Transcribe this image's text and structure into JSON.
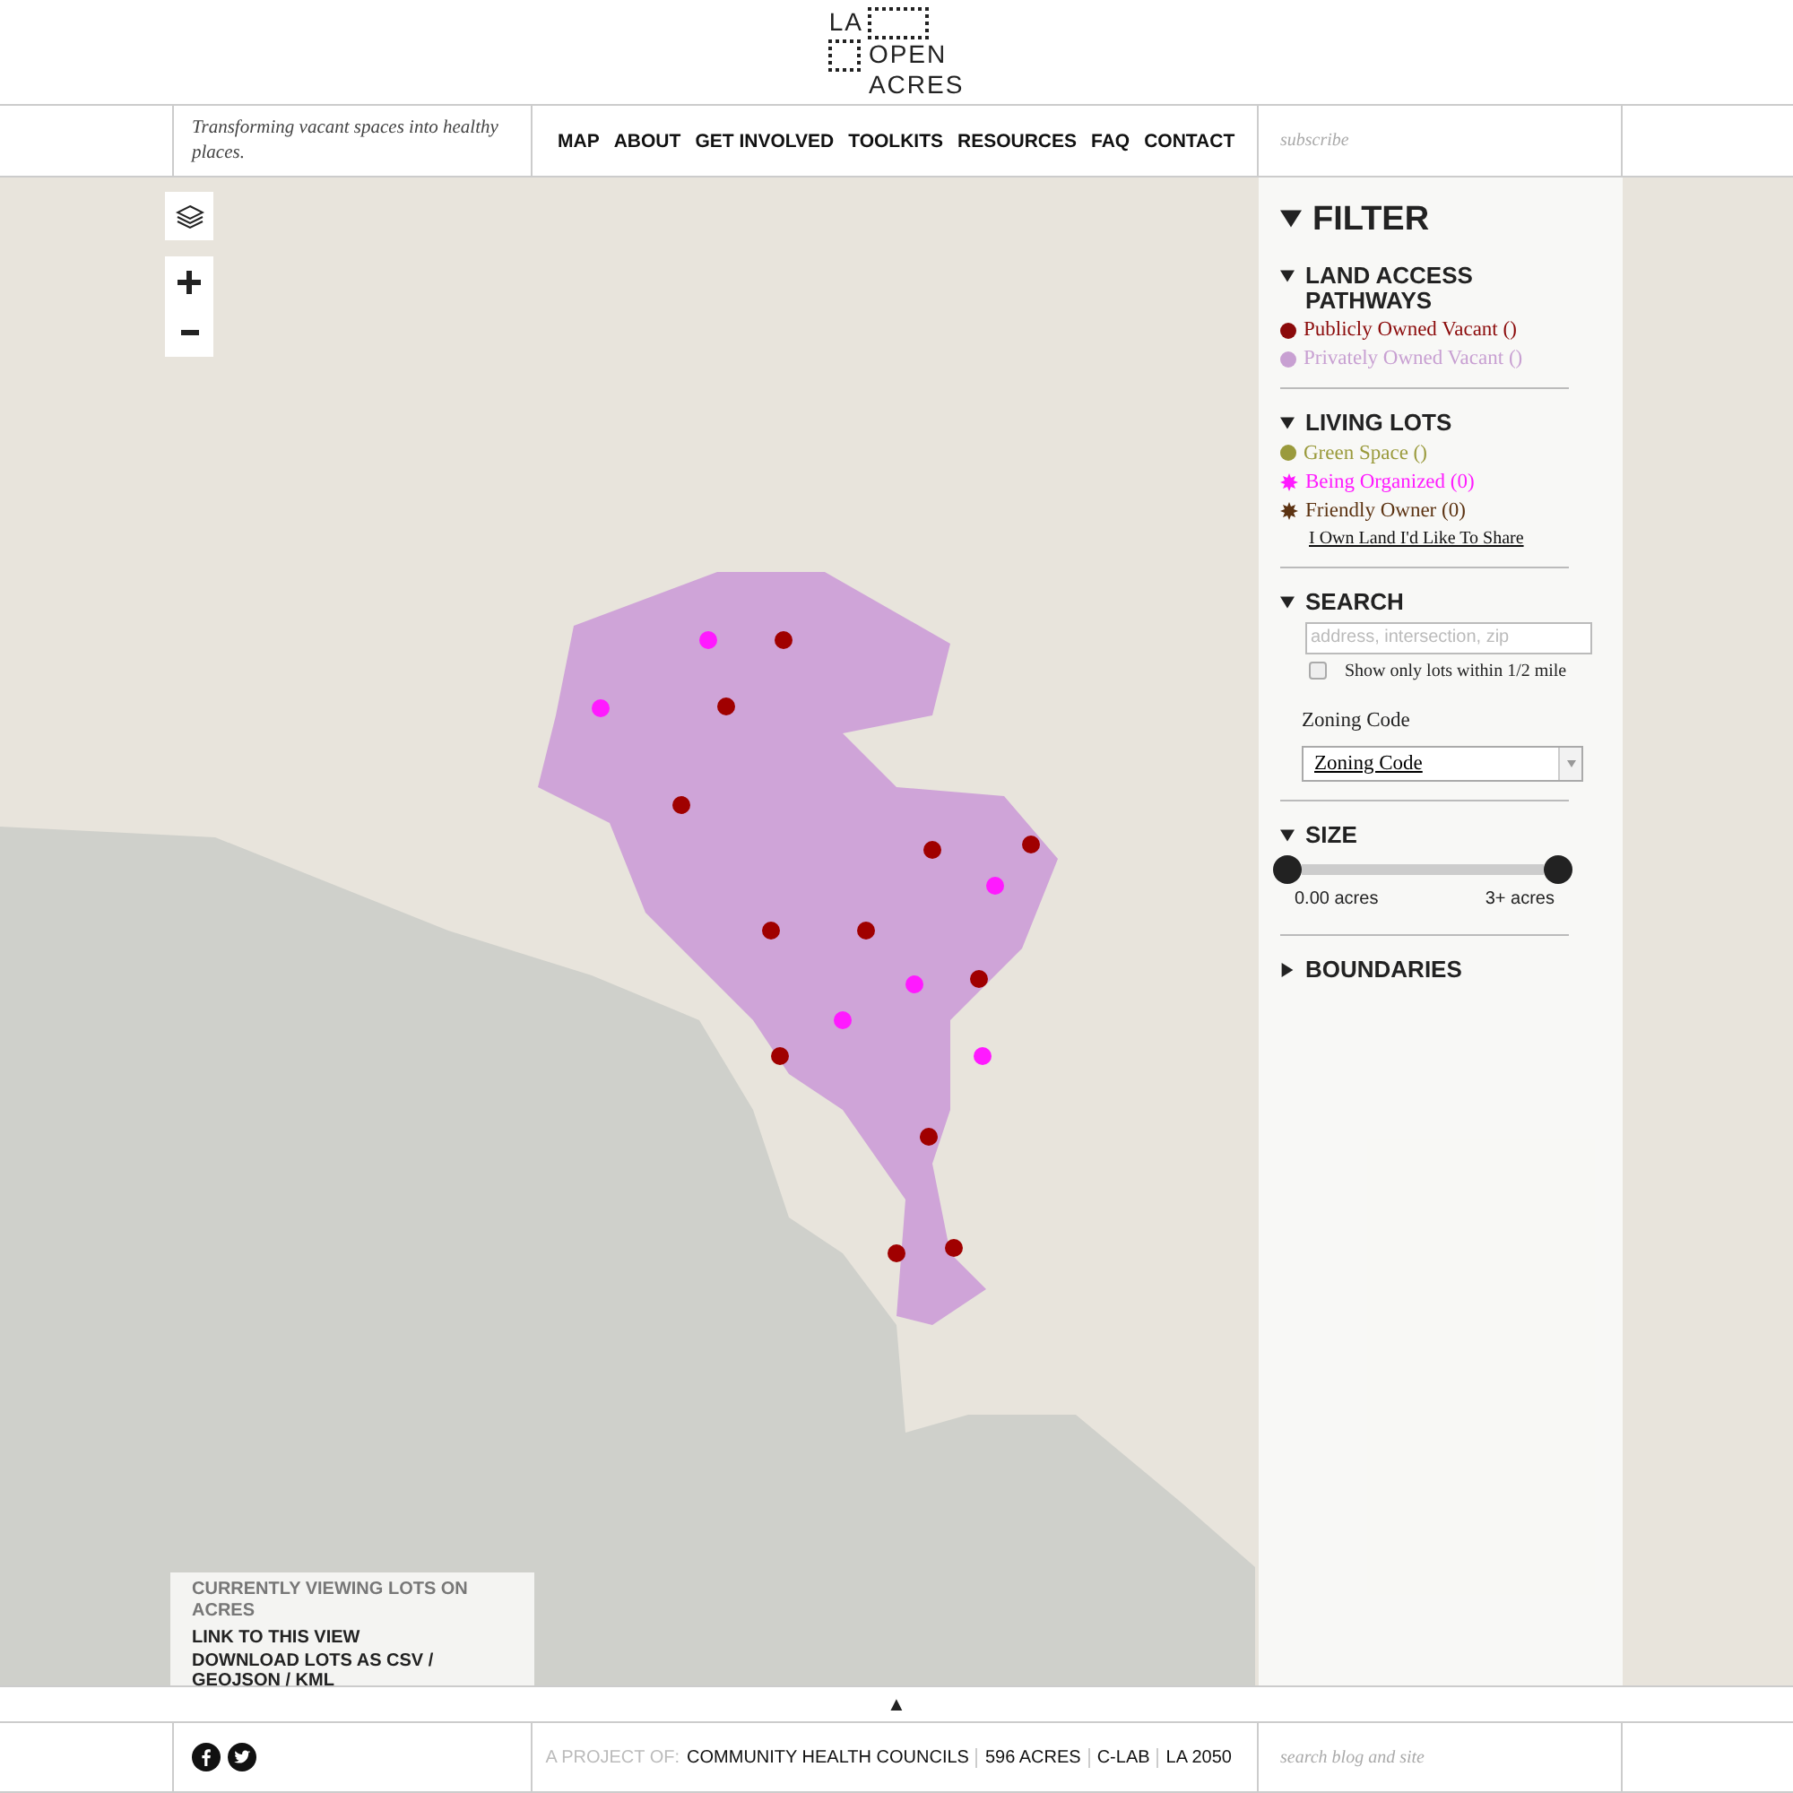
{
  "logo": {
    "line_1": "LA",
    "line_2": "OPEN",
    "line_3": "ACRES"
  },
  "tagline": "Transforming vacant spaces into healthy places.",
  "nav": [
    "MAP",
    "ABOUT",
    "GET INVOLVED",
    "TOOLKITS",
    "RESOURCES",
    "FAQ",
    "CONTACT"
  ],
  "subscribe": {
    "placeholder": "subscribe"
  },
  "filter": {
    "title": "FILTER",
    "expanded": true,
    "sections": [
      {
        "kind": "legend",
        "title": "LAND ACCESS PATHWAYS",
        "expanded": true,
        "items": [
          {
            "label": "Publicly Owned Vacant ()",
            "kind": "dot",
            "color": "#8b0a0a"
          },
          {
            "label": "Privately Owned Vacant ()",
            "kind": "dot",
            "color": "#c8a0d2"
          }
        ]
      },
      {
        "kind": "legend",
        "title": "LIVING LOTS",
        "expanded": true,
        "items": [
          {
            "label": "Green Space ()",
            "kind": "dot",
            "color": "#9a9a3c"
          },
          {
            "label": "Being Organized (0)",
            "kind": "star",
            "color": "#ff1aff"
          },
          {
            "label": "Friendly Owner (0)",
            "kind": "star",
            "color": "#5c3312"
          }
        ],
        "link": "I Own Land I'd Like To Share"
      },
      {
        "kind": "search",
        "title": "SEARCH",
        "expanded": true,
        "placeholder": "address, intersection, zip",
        "checkbox": {
          "label": "Show only lots within 1/2 mile",
          "checked": false
        },
        "select_label": "Zoning Code",
        "select_value": "Zoning Code"
      },
      {
        "kind": "size",
        "title": "SIZE",
        "expanded": true,
        "thumbs": [
          {
            "level": 0,
            "label": "0.00 acres"
          },
          {
            "level": 1,
            "label": "3+ acres"
          }
        ]
      },
      {
        "title": "BOUNDARIES",
        "expanded": false
      }
    ]
  },
  "info_box": {
    "heading": "CURRENTLY VIEWING LOTS ON ACRES",
    "links": [
      "LINK TO THIS VIEW",
      "DOWNLOAD LOTS AS CSV / GEOJSON / KML"
    ]
  },
  "toggle": "▲",
  "footer": {
    "project_label": "A PROJECT OF:",
    "partners": [
      "COMMUNITY HEALTH COUNCILS",
      "596 ACRES",
      "C-LAB",
      "LA 2050"
    ],
    "search": {
      "placeholder": "search blog and site"
    }
  }
}
